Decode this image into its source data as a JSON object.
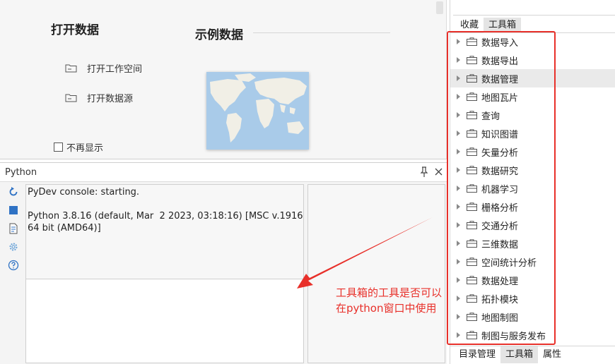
{
  "start_page": {
    "open_title": "打开数据",
    "example_title": "示例数据",
    "open_workspace": "打开工作空间",
    "open_datasource": "打开数据源",
    "dont_show_again": "不再显示"
  },
  "python_panel": {
    "title": "Python",
    "console_lines": [
      "PyDev console: starting.",
      "",
      "Python 3.8.16 (default, Mar  2 2023, 03:18:16) [MSC v.1916 64 bit (AMD64)]"
    ],
    "tools": [
      "refresh-icon",
      "stop-icon",
      "document-icon",
      "gear-icon",
      "help-icon"
    ]
  },
  "annotation": {
    "text": "工具箱的工具是否可以在python窗口中使用",
    "color": "#e8302a"
  },
  "right_dock": {
    "top_tabs": [
      "收藏",
      "工具箱"
    ],
    "top_active": "工具箱",
    "toolbox_items": [
      "数据导入",
      "数据导出",
      "数据管理",
      "地图瓦片",
      "查询",
      "知识图谱",
      "矢量分析",
      "数据研究",
      "机器学习",
      "栅格分析",
      "交通分析",
      "三维数据",
      "空间统计分析",
      "数据处理",
      "拓扑模块",
      "地图制图",
      "制图与服务发布"
    ],
    "highlighted_item": "数据管理",
    "bottom_tabs": [
      "目录管理",
      "工具箱",
      "属性"
    ],
    "bottom_active": "工具箱"
  }
}
